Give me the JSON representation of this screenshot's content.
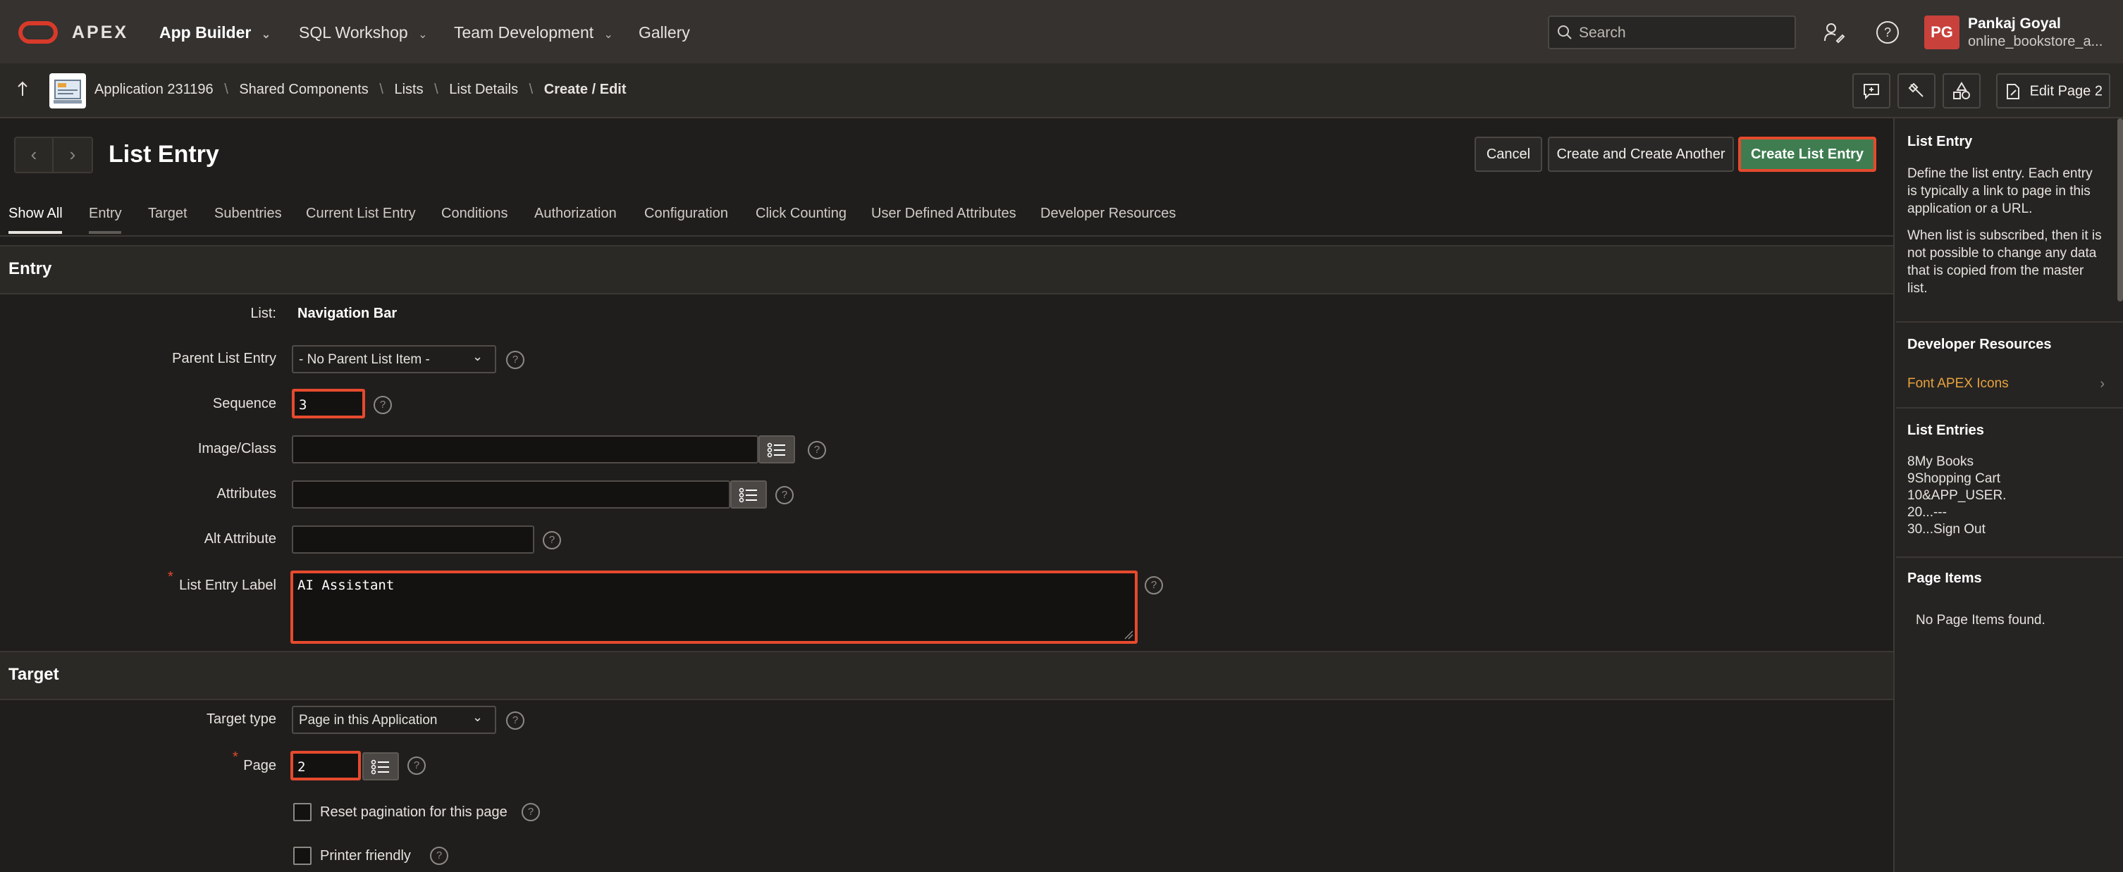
{
  "header": {
    "brand": "APEX",
    "nav": [
      {
        "label": "App Builder"
      },
      {
        "label": "SQL Workshop"
      },
      {
        "label": "Team Development"
      },
      {
        "label": "Gallery"
      }
    ],
    "search_placeholder": "Search",
    "user": {
      "initials": "PG",
      "name": "Pankaj Goyal",
      "workspace": "online_bookstore_a..."
    }
  },
  "breadcrumb": {
    "items": [
      "Application 231196",
      "Shared Components",
      "Lists",
      "List Details",
      "Create / Edit"
    ],
    "edit_page_label": "Edit Page 2"
  },
  "page": {
    "title": "List Entry",
    "buttons": {
      "cancel": "Cancel",
      "create_another": "Create and Create Another",
      "create": "Create List Entry"
    },
    "tabs": [
      "Show All",
      "Entry",
      "Target",
      "Subentries",
      "Current List Entry",
      "Conditions",
      "Authorization",
      "Configuration",
      "Click Counting",
      "User Defined Attributes",
      "Developer Resources"
    ],
    "active_tab": "Show All"
  },
  "entry": {
    "title": "Entry",
    "list_label": "List:",
    "list_value": "Navigation Bar",
    "parent_label": "Parent List Entry",
    "parent_value": "- No Parent List Item -",
    "sequence_label": "Sequence",
    "sequence_value": "3",
    "image_label": "Image/Class",
    "image_value": "",
    "attributes_label": "Attributes",
    "attributes_value": "",
    "alt_label": "Alt Attribute",
    "alt_value": "",
    "entry_label_label": "List Entry Label",
    "entry_label_value": "AI Assistant"
  },
  "target": {
    "title": "Target",
    "type_label": "Target type",
    "type_value": "Page in this Application",
    "page_label": "Page",
    "page_value": "2",
    "reset_label": "Reset pagination for this page",
    "printer_label": "Printer friendly"
  },
  "help_panel": {
    "title": "List Entry",
    "p1": "Define the list entry. Each entry is typically a link to page in this application or a URL.",
    "p2": "When list is subscribed, then it is not possible to change any data that is copied from the master list.",
    "dev_title": "Developer Resources",
    "dev_link": "Font APEX Icons",
    "entries_title": "List Entries",
    "entries": [
      "8My Books",
      "9Shopping Cart",
      "10&APP_USER.",
      "20...---",
      "30...Sign Out"
    ],
    "items_title": "Page Items",
    "items_empty": "No Page Items found."
  },
  "colors": {
    "accent": "#e64a2e",
    "primary_button": "#3f7d51",
    "link": "#e8a33d",
    "background": "#201e1c"
  }
}
